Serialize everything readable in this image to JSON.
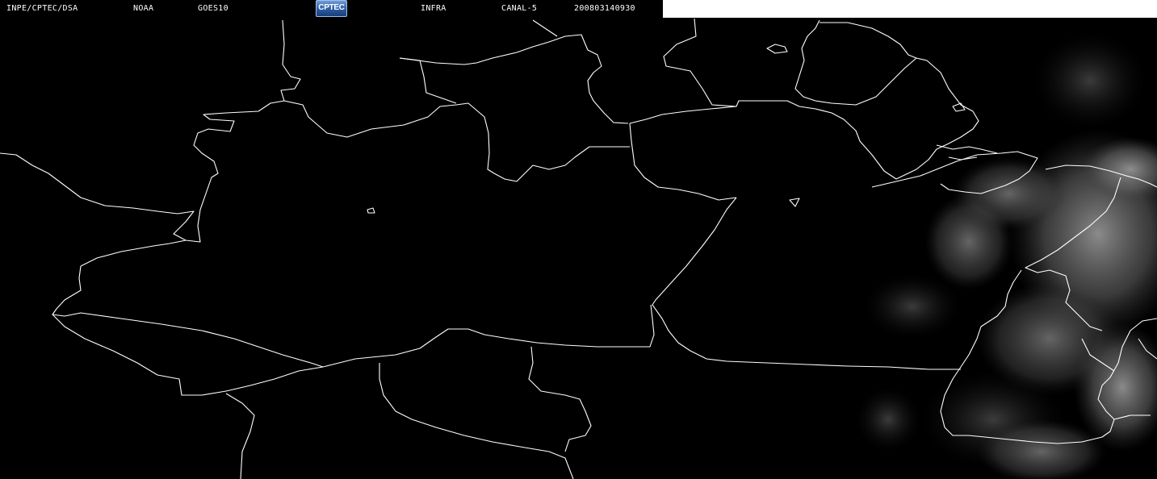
{
  "header": {
    "institution": "INPE/CPTEC/DSA",
    "agency": "NOAA",
    "satellite": "GOES10",
    "logo_text": "CPTEC",
    "band_type": "INFRA",
    "channel": "CANAL-5",
    "timestamp": "200803140930"
  },
  "colors": {
    "background": "#000000",
    "border_lines": "#ffffff",
    "cloud_tone": "#8a8a8a",
    "logo_blue": "#2f5fa8"
  },
  "map": {
    "kind": "infrared satellite image with political boundaries"
  }
}
